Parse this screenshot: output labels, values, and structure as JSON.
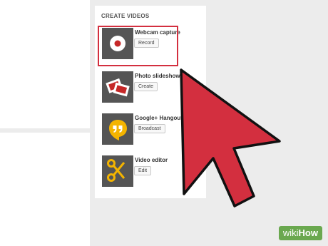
{
  "panel": {
    "heading": "CREATE VIDEOS",
    "items": [
      {
        "title": "Webcam capture",
        "button": "Record",
        "icon": "record-icon"
      },
      {
        "title": "Photo slideshow",
        "button": "Create",
        "icon": "photos-icon"
      },
      {
        "title": "Google+ Hangouts",
        "button": "Broadcast",
        "icon": "hangouts-icon"
      },
      {
        "title": "Video editor",
        "button": "Edit",
        "icon": "scissors-icon"
      }
    ]
  },
  "annotation": {
    "highlight_color": "#d32f3f",
    "arrow_color": "#d32f3f"
  },
  "watermark": {
    "prefix": "wiki",
    "brand": "How",
    "color": "#6aa84f"
  }
}
